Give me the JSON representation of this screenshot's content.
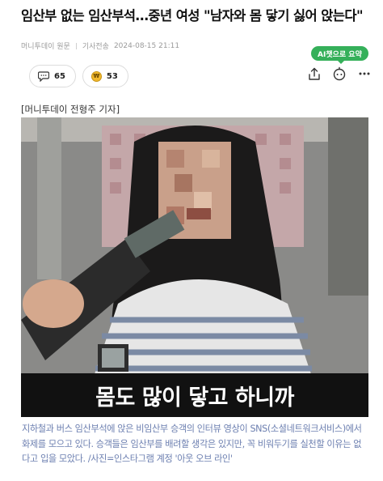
{
  "article": {
    "headline": "임산부 없는 임산부석…중년 여성 \"남자와 몸 닿기 싫어 앉는다\"",
    "source": "머니투데이 원문",
    "author_label": "기사전송",
    "timestamp": "2024-08-15 21:11",
    "byline": "[머니투데이 전형주 기자]",
    "photo_subtitle": "몸도 많이 닿고 하니까",
    "caption": "지하철과 버스 임산부석에 앉은 비임산부 승객의 인터뷰 영상이 SNS(소셜네트워크서비스)에서 화제를 모으고 있다. 승객들은 임산부를 배려할 생각은 있지만, 꼭 비워두기를 실천할 이유는 없다고 입을 모았다. /사진=인스타그램 계정 '아웃 오브 라인'"
  },
  "reactions": {
    "comments_count": "65",
    "coin_count": "53"
  },
  "toolbar": {
    "ai_badge_label": "AI챗으로 요약",
    "icons": [
      "share-icon",
      "ai-chat-icon",
      "more-icon"
    ]
  },
  "colors": {
    "ai_badge": "#35b05a",
    "caption": "#6c7fb0",
    "coin": "#f1b82c"
  }
}
